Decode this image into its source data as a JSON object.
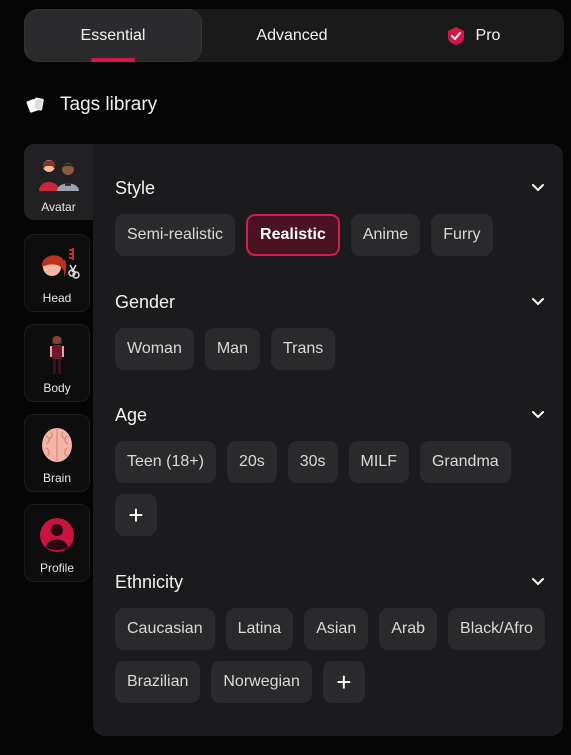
{
  "tabs": [
    {
      "label": "Essential",
      "active": true
    },
    {
      "label": "Advanced",
      "active": false
    },
    {
      "label": "Pro",
      "active": false,
      "icon": "pro-shield-check-icon"
    }
  ],
  "library": {
    "title": "Tags library",
    "icon": "tags-icon"
  },
  "sidebar": {
    "items": [
      {
        "label": "Avatar",
        "icon": "avatar-couple-icon",
        "active": true
      },
      {
        "label": "Head",
        "icon": "head-haircut-icon",
        "active": false
      },
      {
        "label": "Body",
        "icon": "body-figure-icon",
        "active": false
      },
      {
        "label": "Brain",
        "icon": "brain-icon",
        "active": false
      },
      {
        "label": "Profile",
        "icon": "profile-icon",
        "active": false
      }
    ]
  },
  "sections": {
    "style": {
      "title": "Style",
      "chips": [
        "Semi-realistic",
        "Realistic",
        "Anime",
        "Furry"
      ],
      "selected": "Realistic"
    },
    "gender": {
      "title": "Gender",
      "chips": [
        "Woman",
        "Man",
        "Trans"
      ]
    },
    "age": {
      "title": "Age",
      "chips": [
        "Teen (18+)",
        "20s",
        "30s",
        "MILF",
        "Grandma"
      ],
      "plus": "+"
    },
    "ethnicity": {
      "title": "Ethnicity",
      "chips": [
        "Caucasian",
        "Latina",
        "Asian",
        "Arab",
        "Black/Afro",
        "Brazilian",
        "Norwegian"
      ],
      "plus": "+"
    }
  },
  "colors": {
    "accent": "#d4174a",
    "selected_bg": "#4a1324",
    "chip_bg": "#2a2a2c",
    "panel_bg": "#1b1b1d"
  }
}
